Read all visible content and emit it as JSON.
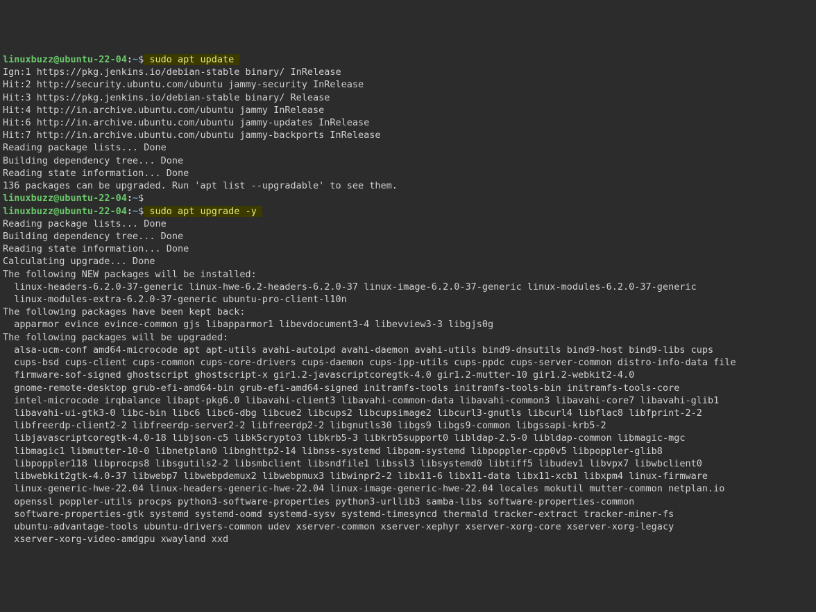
{
  "prompt": {
    "user": "linuxbuzz",
    "at": "@",
    "host": "ubuntu-22-04",
    "colon": ":",
    "path": "~",
    "dollar": "$"
  },
  "cmd1": " sudo apt update ",
  "out1": [
    "Ign:1 https://pkg.jenkins.io/debian-stable binary/ InRelease",
    "Hit:2 http://security.ubuntu.com/ubuntu jammy-security InRelease",
    "Hit:3 https://pkg.jenkins.io/debian-stable binary/ Release",
    "Hit:4 http://in.archive.ubuntu.com/ubuntu jammy InRelease",
    "Hit:6 http://in.archive.ubuntu.com/ubuntu jammy-updates InRelease",
    "Hit:7 http://in.archive.ubuntu.com/ubuntu jammy-backports InRelease",
    "Reading package lists... Done",
    "Building dependency tree... Done",
    "Reading state information... Done",
    "136 packages can be upgraded. Run 'apt list --upgradable' to see them."
  ],
  "cmd2_empty": "",
  "cmd3": " sudo apt upgrade -y ",
  "out2": [
    "Reading package lists... Done",
    "Building dependency tree... Done",
    "Reading state information... Done",
    "Calculating upgrade... Done",
    "The following NEW packages will be installed:",
    "  linux-headers-6.2.0-37-generic linux-hwe-6.2-headers-6.2.0-37 linux-image-6.2.0-37-generic linux-modules-6.2.0-37-generic",
    "  linux-modules-extra-6.2.0-37-generic ubuntu-pro-client-l10n",
    "The following packages have been kept back:",
    "  apparmor evince evince-common gjs libapparmor1 libevdocument3-4 libevview3-3 libgjs0g",
    "The following packages will be upgraded:",
    "  alsa-ucm-conf amd64-microcode apt apt-utils avahi-autoipd avahi-daemon avahi-utils bind9-dnsutils bind9-host bind9-libs cups",
    "  cups-bsd cups-client cups-common cups-core-drivers cups-daemon cups-ipp-utils cups-ppdc cups-server-common distro-info-data file",
    "  firmware-sof-signed ghostscript ghostscript-x gir1.2-javascriptcoregtk-4.0 gir1.2-mutter-10 gir1.2-webkit2-4.0",
    "  gnome-remote-desktop grub-efi-amd64-bin grub-efi-amd64-signed initramfs-tools initramfs-tools-bin initramfs-tools-core",
    "  intel-microcode irqbalance libapt-pkg6.0 libavahi-client3 libavahi-common-data libavahi-common3 libavahi-core7 libavahi-glib1",
    "  libavahi-ui-gtk3-0 libc-bin libc6 libc6-dbg libcue2 libcups2 libcupsimage2 libcurl3-gnutls libcurl4 libflac8 libfprint-2-2",
    "  libfreerdp-client2-2 libfreerdp-server2-2 libfreerdp2-2 libgnutls30 libgs9 libgs9-common libgssapi-krb5-2",
    "  libjavascriptcoregtk-4.0-18 libjson-c5 libk5crypto3 libkrb5-3 libkrb5support0 libldap-2.5-0 libldap-common libmagic-mgc",
    "  libmagic1 libmutter-10-0 libnetplan0 libnghttp2-14 libnss-systemd libpam-systemd libpoppler-cpp0v5 libpoppler-glib8",
    "  libpoppler118 libprocps8 libsgutils2-2 libsmbclient libsndfile1 libssl3 libsystemd0 libtiff5 libudev1 libvpx7 libwbclient0",
    "  libwebkit2gtk-4.0-37 libwebp7 libwebpdemux2 libwebpmux3 libwinpr2-2 libx11-6 libx11-data libx11-xcb1 libxpm4 linux-firmware",
    "  linux-generic-hwe-22.04 linux-headers-generic-hwe-22.04 linux-image-generic-hwe-22.04 locales mokutil mutter-common netplan.io",
    "  openssl poppler-utils procps python3-software-properties python3-urllib3 samba-libs software-properties-common",
    "  software-properties-gtk systemd systemd-oomd systemd-sysv systemd-timesyncd thermald tracker-extract tracker-miner-fs",
    "  ubuntu-advantage-tools ubuntu-drivers-common udev xserver-common xserver-xephyr xserver-xorg-core xserver-xorg-legacy",
    "  xserver-xorg-video-amdgpu xwayland xxd"
  ]
}
